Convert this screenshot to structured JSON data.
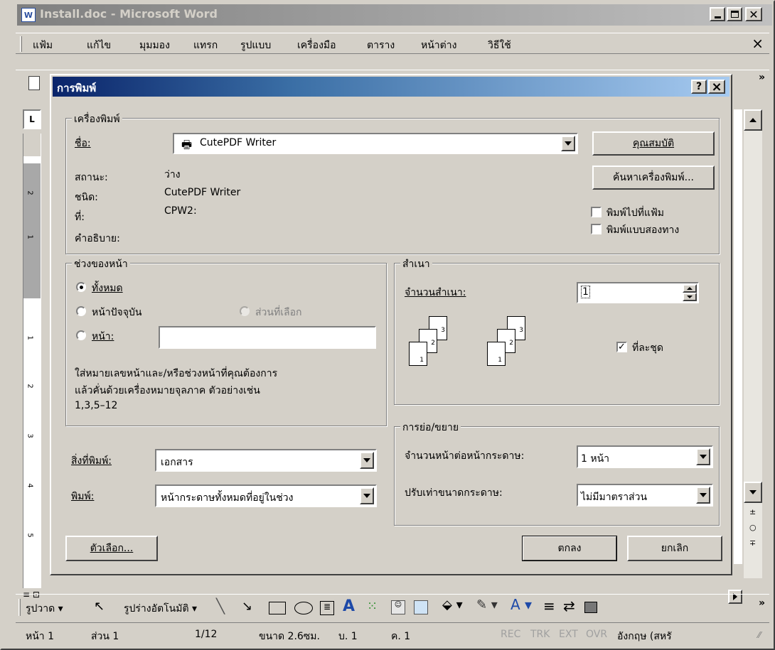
{
  "word": {
    "title": "Install.doc - Microsoft Word",
    "menu": [
      "แฟ้ม",
      "แก้ไข",
      "มุมมอง",
      "แทรก",
      "รูปแบบ",
      "เครื่องมือ",
      "ตาราง",
      "หน้าต่าง",
      "วิธีใช้"
    ],
    "close_doc_glyph": "×",
    "drawing_toolbar": {
      "draw_label": "รูปวาด",
      "autoshapes_label": "รูปร่างอัตโนมัติ"
    },
    "status_bar": {
      "page": "หน้า 1",
      "section": "ส่วน 1",
      "page_of": "1/12",
      "at": "ขนาด 2.6ซม.",
      "line": "บ. 1",
      "col": "ค. 1",
      "rec": "REC",
      "trk": "TRK",
      "ext": "EXT",
      "ovr": "OVR",
      "language": "อังกฤษ (สหรั"
    }
  },
  "dialog": {
    "title": "การพิมพ์",
    "help_glyph": "?",
    "close_glyph": "×",
    "printer": {
      "group_label": "เครื่องพิมพ์",
      "name_label": "ชื่อ:",
      "name_value": "CutePDF Writer",
      "properties_button": "คุณสมบัติ",
      "find_printer_button": "ค้นหาเครื่องพิมพ์...",
      "status_label": "สถานะ:",
      "status_value": "ว่าง",
      "type_label": "ชนิด:",
      "type_value": "CutePDF Writer",
      "where_label": "ที่:",
      "where_value": "CPW2:",
      "comment_label": "คำอธิบาย:",
      "print_to_file": "พิมพ์ไปที่แฟ้ม",
      "print_to_file_checked": false,
      "manual_duplex": "พิมพ์แบบสองทาง",
      "manual_duplex_checked": false
    },
    "page_range": {
      "group_label": "ช่วงของหน้า",
      "all": "ทั้งหมด",
      "current_page": "หน้าปัจจุบัน",
      "selection": "ส่วนที่เลือก",
      "pages": "หน้า:",
      "pages_value": "",
      "selected": "all",
      "hint_line1": "ใส่หมายเลขหน้าและ/หรือช่วงหน้าที่คุณต้องการ",
      "hint_line2": "แล้วคั่นด้วยเครื่องหมายจุลภาค  ตัวอย่างเช่น",
      "hint_line3": "1,3,5–12"
    },
    "copies": {
      "group_label": "สำเนา",
      "number_label": "จำนวนสำเนา:",
      "number_value": "1",
      "collate": "ที่ละชุด",
      "collate_checked": true,
      "page_numbers": [
        "1",
        "2",
        "3"
      ]
    },
    "print_what_label": "สิ่งที่พิมพ์:",
    "print_what_value": "เอกสาร",
    "print_label": "พิมพ์:",
    "print_value": "หน้ากระดาษทั้งหมดที่อยู่ในช่วง",
    "zoom": {
      "group_label": "การย่อ/ขยาย",
      "pages_per_sheet_label": "จำนวนหน้าต่อหน้ากระดาษ:",
      "pages_per_sheet_value": "1 หน้า",
      "scale_label": "ปรับเท่าขนาดกระดาษ:",
      "scale_value": "ไม่มีมาตราส่วน"
    },
    "options_button": "ตัวเลือก...",
    "ok_button": "ตกลง",
    "cancel_button": "ยกเลิก"
  },
  "colors": {
    "face": "#d4d0c8",
    "titlebar_active_from": "#0a246a",
    "titlebar_active_to": "#a6caf0",
    "titlebar_inactive_from": "#808080",
    "titlebar_inactive_to": "#c0c0c0"
  }
}
